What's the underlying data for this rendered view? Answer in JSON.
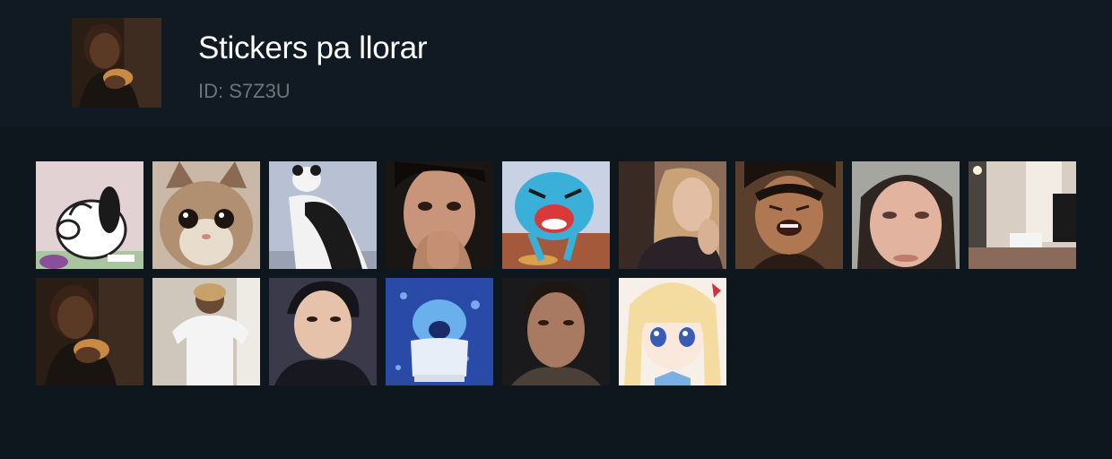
{
  "pack": {
    "title": "Stickers pa llorar",
    "id_label": "ID: S7Z3U",
    "cover_sticker": "crying-toddler-eating"
  },
  "stickers": [
    {
      "name": "snoopy-crying"
    },
    {
      "name": "crying-kitten"
    },
    {
      "name": "sad-panda"
    },
    {
      "name": "man-covering-mouth"
    },
    {
      "name": "gumball-crying"
    },
    {
      "name": "woman-sad-selfie"
    },
    {
      "name": "girl-crying"
    },
    {
      "name": "woman-teary-eyes"
    },
    {
      "name": "empty-room"
    },
    {
      "name": "crying-toddler-eating"
    },
    {
      "name": "person-white-shirt"
    },
    {
      "name": "man-teary"
    },
    {
      "name": "sadness-crying"
    },
    {
      "name": "man-sad-stare"
    },
    {
      "name": "anime-girl-teary"
    }
  ],
  "colors": {
    "header_bg": "#111a22",
    "page_bg": "#0e161e",
    "title": "#ffffff",
    "id_text": "#6d747b"
  }
}
